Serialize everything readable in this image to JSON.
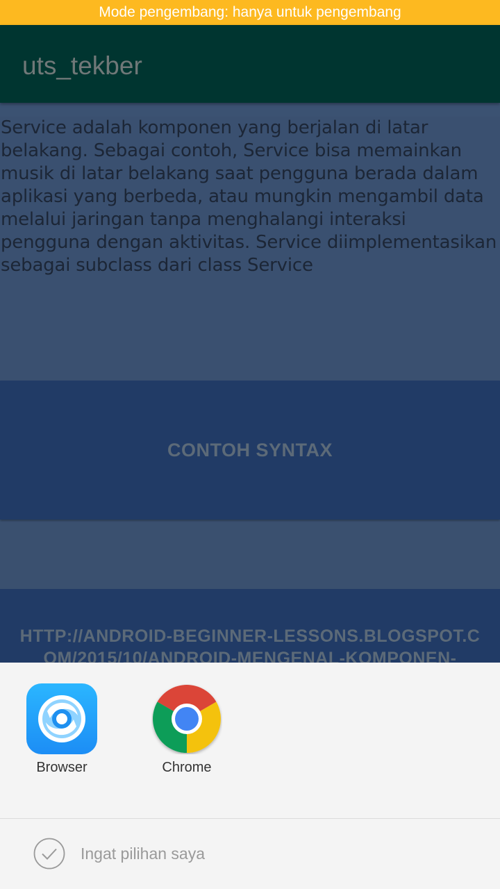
{
  "status_bar": {
    "text": "Mode pengembang: hanya untuk pengembang",
    "color": "#fdb920"
  },
  "app_bar": {
    "title": "uts_tekber",
    "color": "#003530"
  },
  "content": {
    "description": "Service adalah komponen yang berjalan di latar belakang. Sebagai contoh, Service bisa memainkan musik di latar belakang saat pengguna berada dalam aplikasi yang berbeda, atau mungkin mengambil data melalui jaringan tanpa menghalangi interaksi pengguna dengan aktivitas. Service diimplementasikan sebagai subclass dari class Service",
    "syntax_button": "CONTOH SYNTAX",
    "link_button": "HTTP://ANDROID-BEGINNER-LESSONS.BLOGSPOT.COM/2015/10/ANDROID-MENGENAL-KOMPONEN-"
  },
  "chooser": {
    "apps": [
      {
        "label": "Browser",
        "icon": "browser-icon"
      },
      {
        "label": "Chrome",
        "icon": "chrome-icon"
      }
    ],
    "remember_label": "Ingat pilihan saya"
  }
}
